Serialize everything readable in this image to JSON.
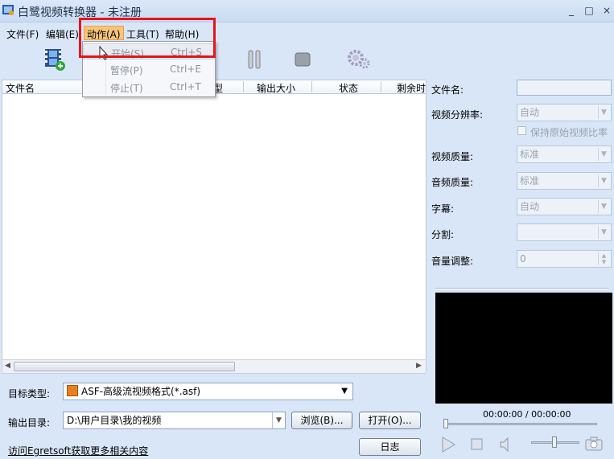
{
  "window": {
    "title": "白鹭视频转换器 - 未注册",
    "minimize": "_",
    "maximize": "□",
    "close": "×"
  },
  "menu": {
    "file": "文件(F)",
    "edit": "编辑(E)",
    "action": "动作(A)",
    "tools": "工具(T)",
    "help": "帮助(H)"
  },
  "action_menu": {
    "start": {
      "label": "开始(S)",
      "shortcut": "Ctrl+S"
    },
    "pause": {
      "label": "暂停(P)",
      "shortcut": "Ctrl+E"
    },
    "stop": {
      "label": "停止(T)",
      "shortcut": "Ctrl+T"
    }
  },
  "list": {
    "columns": [
      "文件名",
      "型",
      "输出大小",
      "状态",
      "剩余时"
    ]
  },
  "bottom": {
    "target_type_label": "目标类型:",
    "target_type_value": "ASF-高级流视频格式(*.asf)",
    "output_dir_label": "输出目录:",
    "output_dir_value": "D:\\用户目录\\我的视频",
    "browse_button": "浏览(B)...",
    "open_button": "打开(O)...",
    "visit_link": "访问Egretsoft获取更多相关内容",
    "log_button": "日志"
  },
  "settings": {
    "filename_label": "文件名:",
    "filename_value": "",
    "resolution_label": "视频分辨率:",
    "resolution_value": "自动",
    "keep_ratio_label": "保持原始视频比率",
    "video_quality_label": "视频质量:",
    "video_quality_value": "标准",
    "audio_quality_label": "音频质量:",
    "audio_quality_value": "标准",
    "subtitle_label": "字幕:",
    "subtitle_value": "自动",
    "split_label": "分割:",
    "split_value": "",
    "volume_label": "音量调整:",
    "volume_value": "0"
  },
  "player": {
    "time": "00:00:00 / 00:00:00"
  },
  "colors": {
    "highlight_box": "#e8141c",
    "menu_active": "#f7c47c",
    "background": "#d9e6f7"
  }
}
